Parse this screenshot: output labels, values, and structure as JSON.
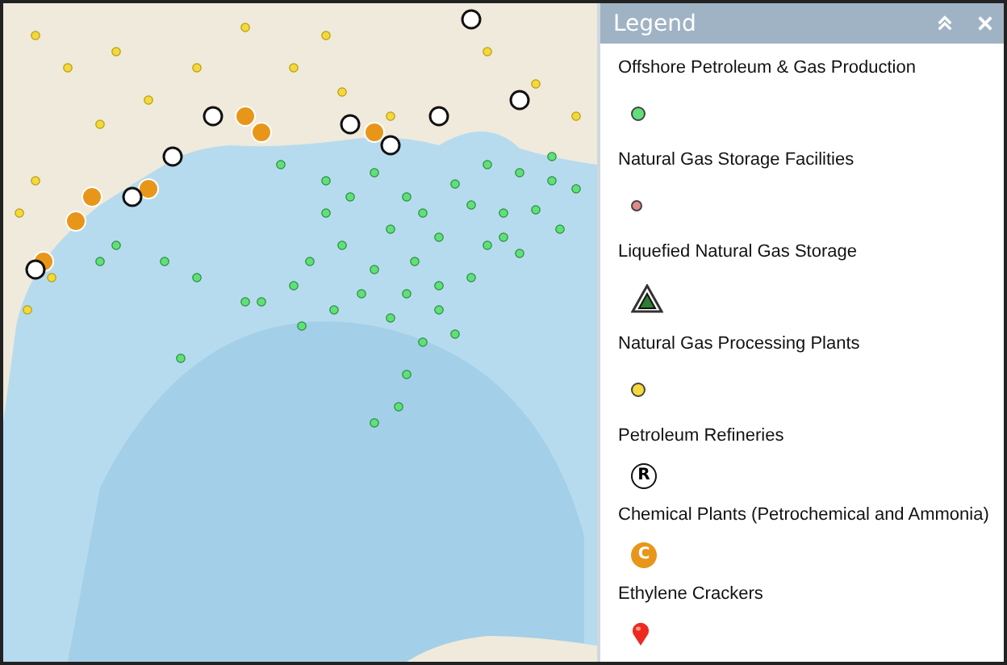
{
  "legend": {
    "title": "Legend",
    "items": [
      {
        "label": "Offshore Petroleum & Gas Production",
        "kind": "dot",
        "color": "#5fe07a"
      },
      {
        "label": "Natural Gas Storage Facilities",
        "kind": "small-dot",
        "color": "#e08a8a"
      },
      {
        "label": "Liquefied Natural Gas Storage",
        "kind": "triangle"
      },
      {
        "label": "Natural Gas Processing Plants",
        "kind": "dot",
        "color": "#f5d83a"
      },
      {
        "label": "Petroleum Refineries",
        "kind": "letter",
        "glyph": "R"
      },
      {
        "label": "Chemical Plants (Petrochemical and Ammonia)",
        "kind": "letter-filled",
        "glyph": "C"
      },
      {
        "label": "Ethylene Crackers",
        "kind": "pin"
      }
    ]
  }
}
